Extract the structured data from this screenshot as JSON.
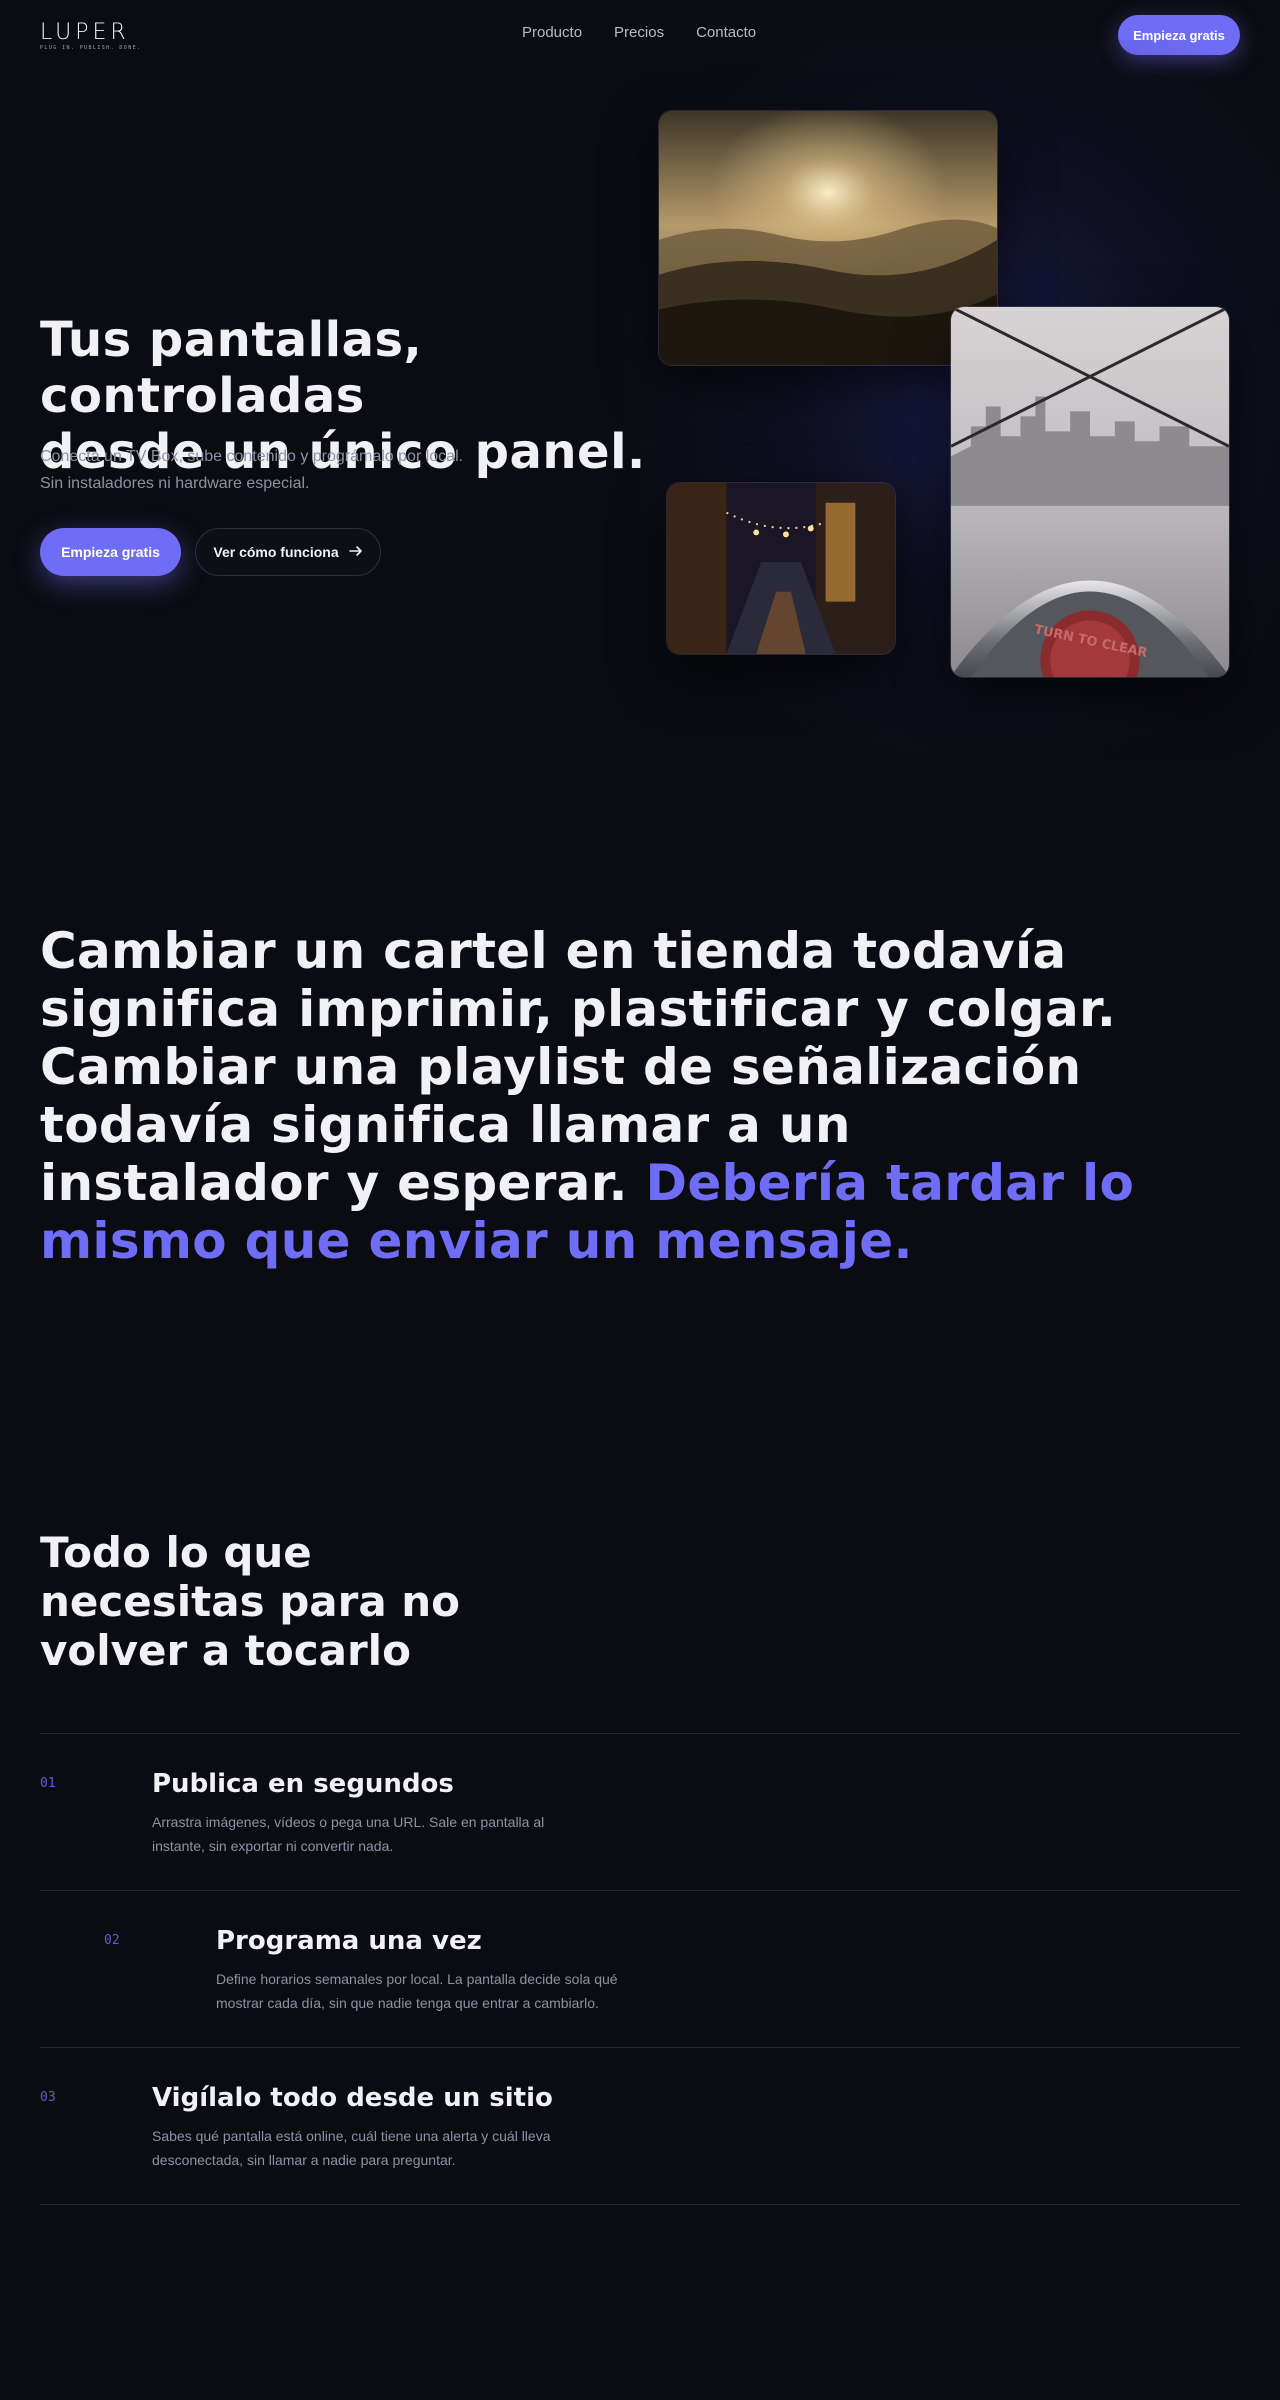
{
  "nav": {
    "logo": "LUPER",
    "tagline": "PLUG IN. PUBLISH. DONE.",
    "links": [
      "Producto",
      "Precios",
      "Contacto"
    ],
    "cta": "Empieza gratis"
  },
  "hero": {
    "title_line1": "Tus pantallas, controladas",
    "title_line2": "desde un único panel.",
    "sub_line1": "Conecta un TV Box, sube contenido y prográmalo por local.",
    "sub_line2": "Sin instaladores ni hardware especial.",
    "primary_cta": "Empieza gratis",
    "secondary_cta": "Ver cómo funciona",
    "sign_text": "TURN TO CLEAR"
  },
  "statement": {
    "text": "Cambiar un cartel en tienda todavía significa imprimir, plastificar y colgar. Cambiar una playlist de señalización todavía significa llamar a un instalador y esperar.",
    "accent": "Debería tardar lo mismo que enviar un mensaje."
  },
  "features": {
    "title": "Todo lo que necesitas para no volver a tocarlo",
    "items": [
      {
        "num": "01",
        "title": "Publica en segundos",
        "desc": "Arrastra imágenes, vídeos o pega una URL. Sale en pantalla al instante, sin exportar ni convertir nada."
      },
      {
        "num": "02",
        "title": "Programa una vez",
        "desc": "Define horarios semanales por local. La pantalla decide sola qué mostrar cada día, sin que nadie tenga que entrar a cambiarlo."
      },
      {
        "num": "03",
        "title": "Vigílalo todo desde un sitio",
        "desc": "Sabes qué pantalla está online, cuál tiene una alerta y cuál lleva desconectada, sin llamar a nadie para preguntar."
      }
    ]
  },
  "colors": {
    "background": "#0b0c12",
    "accent": "#6f6cf6",
    "text": "#f1f1f5",
    "muted": "#8d91a3"
  }
}
